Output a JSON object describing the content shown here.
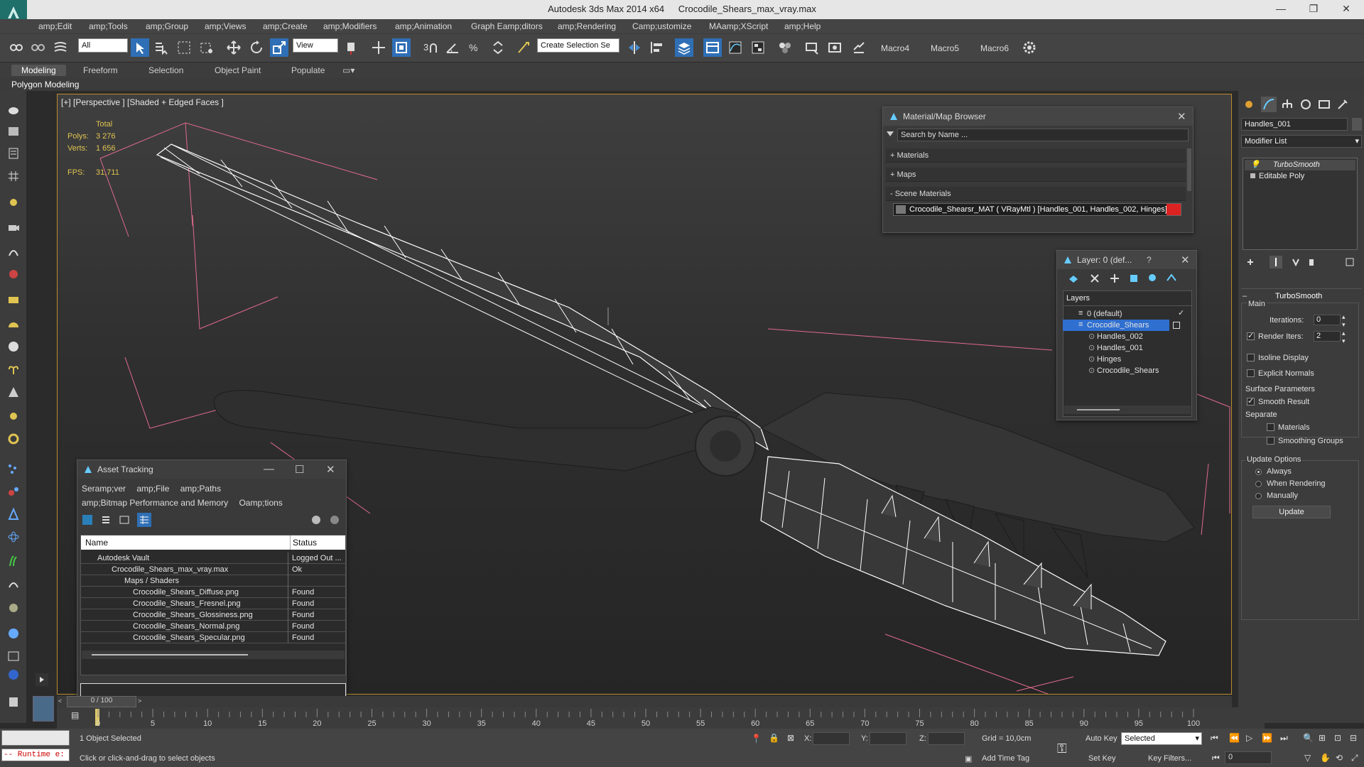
{
  "window": {
    "app_title": "Autodesk 3ds Max  2014 x64",
    "file_title": "Crocodile_Shears_max_vray.max"
  },
  "menu": [
    "amp;Edit",
    "amp;Tools",
    "amp;Group",
    "amp;Views",
    "amp;Create",
    "amp;Modifiers",
    "amp;Animation",
    "Graph Eamp;ditors",
    "amp;Rendering",
    "Camp;ustomize",
    "MAamp;XScript",
    "amp;Help"
  ],
  "toolbar": {
    "selection_filter": "All",
    "ref_coord": "View",
    "named_selection": "Create Selection Se",
    "macros": [
      "Macro4",
      "Macro5",
      "Macro6"
    ]
  },
  "ribbon": {
    "tabs": [
      "Modeling",
      "Freeform",
      "Selection",
      "Object Paint",
      "Populate"
    ],
    "active_tab": "Modeling",
    "panel_label": "Polygon Modeling"
  },
  "viewport": {
    "label": "[+] [Perspective ] [Shaded + Edged Faces ]",
    "stats": {
      "total_label": "Total",
      "polys_label": "Polys:",
      "polys_value": "3 276",
      "verts_label": "Verts:",
      "verts_value": "1 656",
      "fps_label": "FPS:",
      "fps_value": "31,711"
    }
  },
  "material_browser": {
    "title": "Material/Map Browser",
    "search_placeholder": "Search by Name ...",
    "sections": [
      "+ Materials",
      "+ Maps",
      "- Scene Materials"
    ],
    "scene_material": "Crocodile_Shearsr_MAT  ( VRayMtl ) [Handles_001, Handles_002, Hinges]"
  },
  "layer_manager": {
    "title": "Layer: 0 (def...",
    "help": "?",
    "header": "Layers",
    "rows": [
      {
        "label": "0 (default)",
        "indent": 0
      },
      {
        "label": "Crocodile_Shears",
        "indent": 0
      },
      {
        "label": "Handles_002",
        "indent": 1
      },
      {
        "label": "Handles_001",
        "indent": 1
      },
      {
        "label": "Hinges",
        "indent": 1
      },
      {
        "label": "Crocodile_Shears",
        "indent": 1
      }
    ]
  },
  "asset_tracking": {
    "title": "Asset Tracking",
    "menu": [
      "Seramp;ver",
      "amp;File",
      "amp;Paths",
      "amp;Bitmap Performance and Memory",
      "Oamp;tions"
    ],
    "col_name": "Name",
    "col_status": "Status",
    "rows": [
      {
        "name": "Autodesk Vault",
        "status": "Logged Out ...",
        "indent": 1
      },
      {
        "name": "Crocodile_Shears_max_vray.max",
        "status": "Ok",
        "indent": 2
      },
      {
        "name": "Maps / Shaders",
        "status": "",
        "indent": 3
      },
      {
        "name": "Crocodile_Shears_Diffuse.png",
        "status": "Found",
        "indent": 4
      },
      {
        "name": "Crocodile_Shears_Fresnel.png",
        "status": "Found",
        "indent": 4
      },
      {
        "name": "Crocodile_Shears_Glossiness.png",
        "status": "Found",
        "indent": 4
      },
      {
        "name": "Crocodile_Shears_Normal.png",
        "status": "Found",
        "indent": 4
      },
      {
        "name": "Crocodile_Shears_Specular.png",
        "status": "Found",
        "indent": 4
      }
    ]
  },
  "command_panel": {
    "object_name": "Handles_001",
    "modifier_list": "Modifier List",
    "stack": [
      "TurboSmooth",
      "Editable Poly"
    ],
    "rollout_title": "TurboSmooth",
    "main_label": "Main",
    "iterations_label": "Iterations:",
    "iterations_value": "0",
    "render_iters_label": "Render Iters:",
    "render_iters_value": "2",
    "isoline_label": "Isoline Display",
    "explicit_normals_label": "Explicit Normals",
    "surface_params_label": "Surface Parameters",
    "smooth_result_label": "Smooth Result",
    "separate_label": "Separate",
    "materials_label": "Materials",
    "smoothing_groups_label": "Smoothing Groups",
    "update_options_label": "Update Options",
    "always_label": "Always",
    "when_rendering_label": "When Rendering",
    "manually_label": "Manually",
    "update_button": "Update",
    "render_iters_checked": true,
    "smooth_result_checked": true
  },
  "timeline": {
    "frame_counter": "0 / 100",
    "ticks": [
      "0",
      "5",
      "10",
      "15",
      "20",
      "25",
      "30",
      "35",
      "40",
      "45",
      "50",
      "55",
      "60",
      "65",
      "70",
      "75",
      "80",
      "85",
      "90",
      "95",
      "100"
    ]
  },
  "status": {
    "runtime": "-- Runtime e:",
    "selected": "1 Object Selected",
    "prompt": "Click or click-and-drag to select objects",
    "x_label": "X:",
    "y_label": "Y:",
    "z_label": "Z:",
    "grid": "Grid = 10,0cm",
    "add_time_tag": "Add Time Tag",
    "auto_key": "Auto Key",
    "set_key": "Set Key",
    "key_mode": "Selected",
    "key_filters": "Key Filters...",
    "frame_value": "0"
  },
  "icons": [
    "undo-icon",
    "link-icon",
    "select-icon",
    "move-icon",
    "rotate-icon",
    "scale-icon",
    "snap-icon",
    "render-icon",
    "play-icon",
    "key-icon"
  ]
}
